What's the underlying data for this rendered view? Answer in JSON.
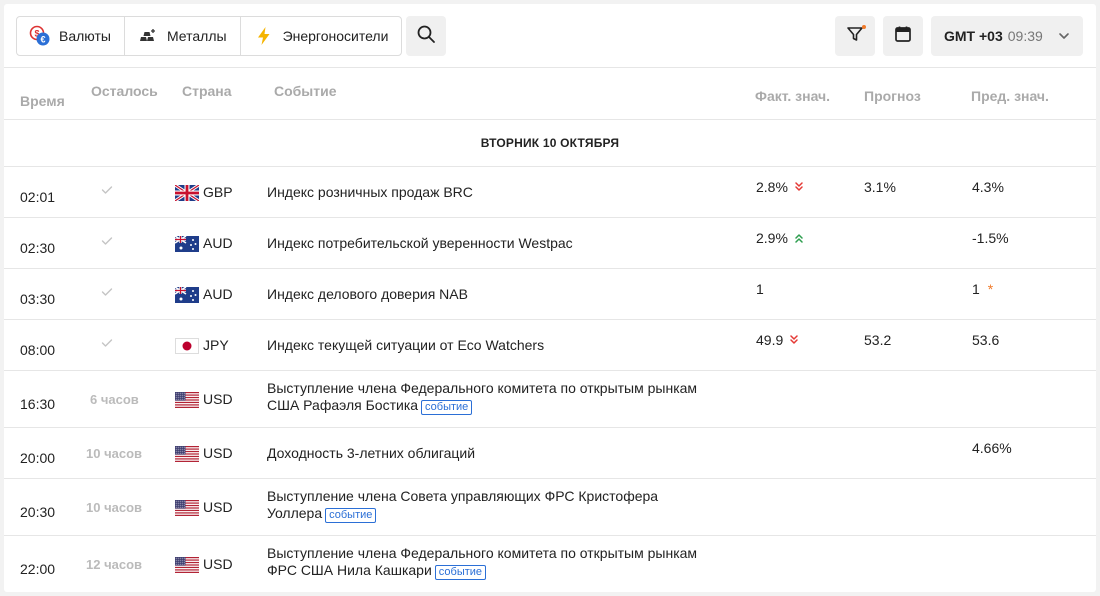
{
  "toolbar": {
    "tabs": [
      {
        "label": "Валюты",
        "icon": "currency-exchange-icon"
      },
      {
        "label": "Металлы",
        "icon": "gold-bars-icon"
      },
      {
        "label": "Энергоносители",
        "icon": "lightning-icon"
      }
    ],
    "timezone_label": "GMT +03",
    "timezone_time": "09:39"
  },
  "columns": {
    "time": "Время",
    "left": "Осталось",
    "country": "Страна",
    "event": "Событие",
    "actual": "Факт. знач.",
    "forecast": "Прогноз",
    "previous": "Пред. знач."
  },
  "day_header": "ВТОРНИК 10 ОКТЯБРЯ",
  "tag_label": "событие",
  "events": [
    {
      "time": "02:01",
      "left": "",
      "done": true,
      "flag": "GB",
      "currency": "GBP",
      "event": "Индекс розничных продаж BRC",
      "tag": false,
      "actual": "2.8%",
      "trend": "down",
      "forecast": "3.1%",
      "previous": "4.3%",
      "revised": false
    },
    {
      "time": "02:30",
      "left": "",
      "done": true,
      "flag": "AU",
      "currency": "AUD",
      "event": "Индекс потребительской уверенности Westpac",
      "tag": false,
      "actual": "2.9%",
      "trend": "up",
      "forecast": "",
      "previous": "-1.5%",
      "revised": false
    },
    {
      "time": "03:30",
      "left": "",
      "done": true,
      "flag": "AU",
      "currency": "AUD",
      "event": "Индекс делового доверия NAB",
      "tag": false,
      "actual": "1",
      "trend": "",
      "forecast": "",
      "previous": "1",
      "revised": true
    },
    {
      "time": "08:00",
      "left": "",
      "done": true,
      "flag": "JP",
      "currency": "JPY",
      "event": "Индекс текущей ситуации от Eco Watchers",
      "tag": false,
      "actual": "49.9",
      "trend": "down",
      "forecast": "53.2",
      "previous": "53.6",
      "revised": false
    },
    {
      "time": "16:30",
      "left": "6 часов",
      "done": false,
      "flag": "US",
      "currency": "USD",
      "event": "Выступление члена Федерального комитета по открытым рынкам США Рафаэля Бостика",
      "tag": true,
      "actual": "",
      "trend": "",
      "forecast": "",
      "previous": "",
      "revised": false
    },
    {
      "time": "20:00",
      "left": "10 часов",
      "done": false,
      "flag": "US",
      "currency": "USD",
      "event": "Доходность 3-летних облигаций",
      "tag": false,
      "actual": "",
      "trend": "",
      "forecast": "",
      "previous": "4.66%",
      "revised": false
    },
    {
      "time": "20:30",
      "left": "10 часов",
      "done": false,
      "flag": "US",
      "currency": "USD",
      "event": "Выступление члена Совета управляющих ФРС Кристофера Уоллера",
      "tag": true,
      "actual": "",
      "trend": "",
      "forecast": "",
      "previous": "",
      "revised": false
    },
    {
      "time": "22:00",
      "left": "12 часов",
      "done": false,
      "flag": "US",
      "currency": "USD",
      "event": "Выступление члена Федерального комитета по открытым рынкам ФРС США Нила Кашкари",
      "tag": true,
      "actual": "",
      "trend": "",
      "forecast": "",
      "previous": "",
      "revised": false
    }
  ],
  "colors": {
    "trend_down": "#e53935",
    "trend_up": "#2e9e4f",
    "revised": "#f07a2a",
    "tag": "#2b6fd6"
  }
}
